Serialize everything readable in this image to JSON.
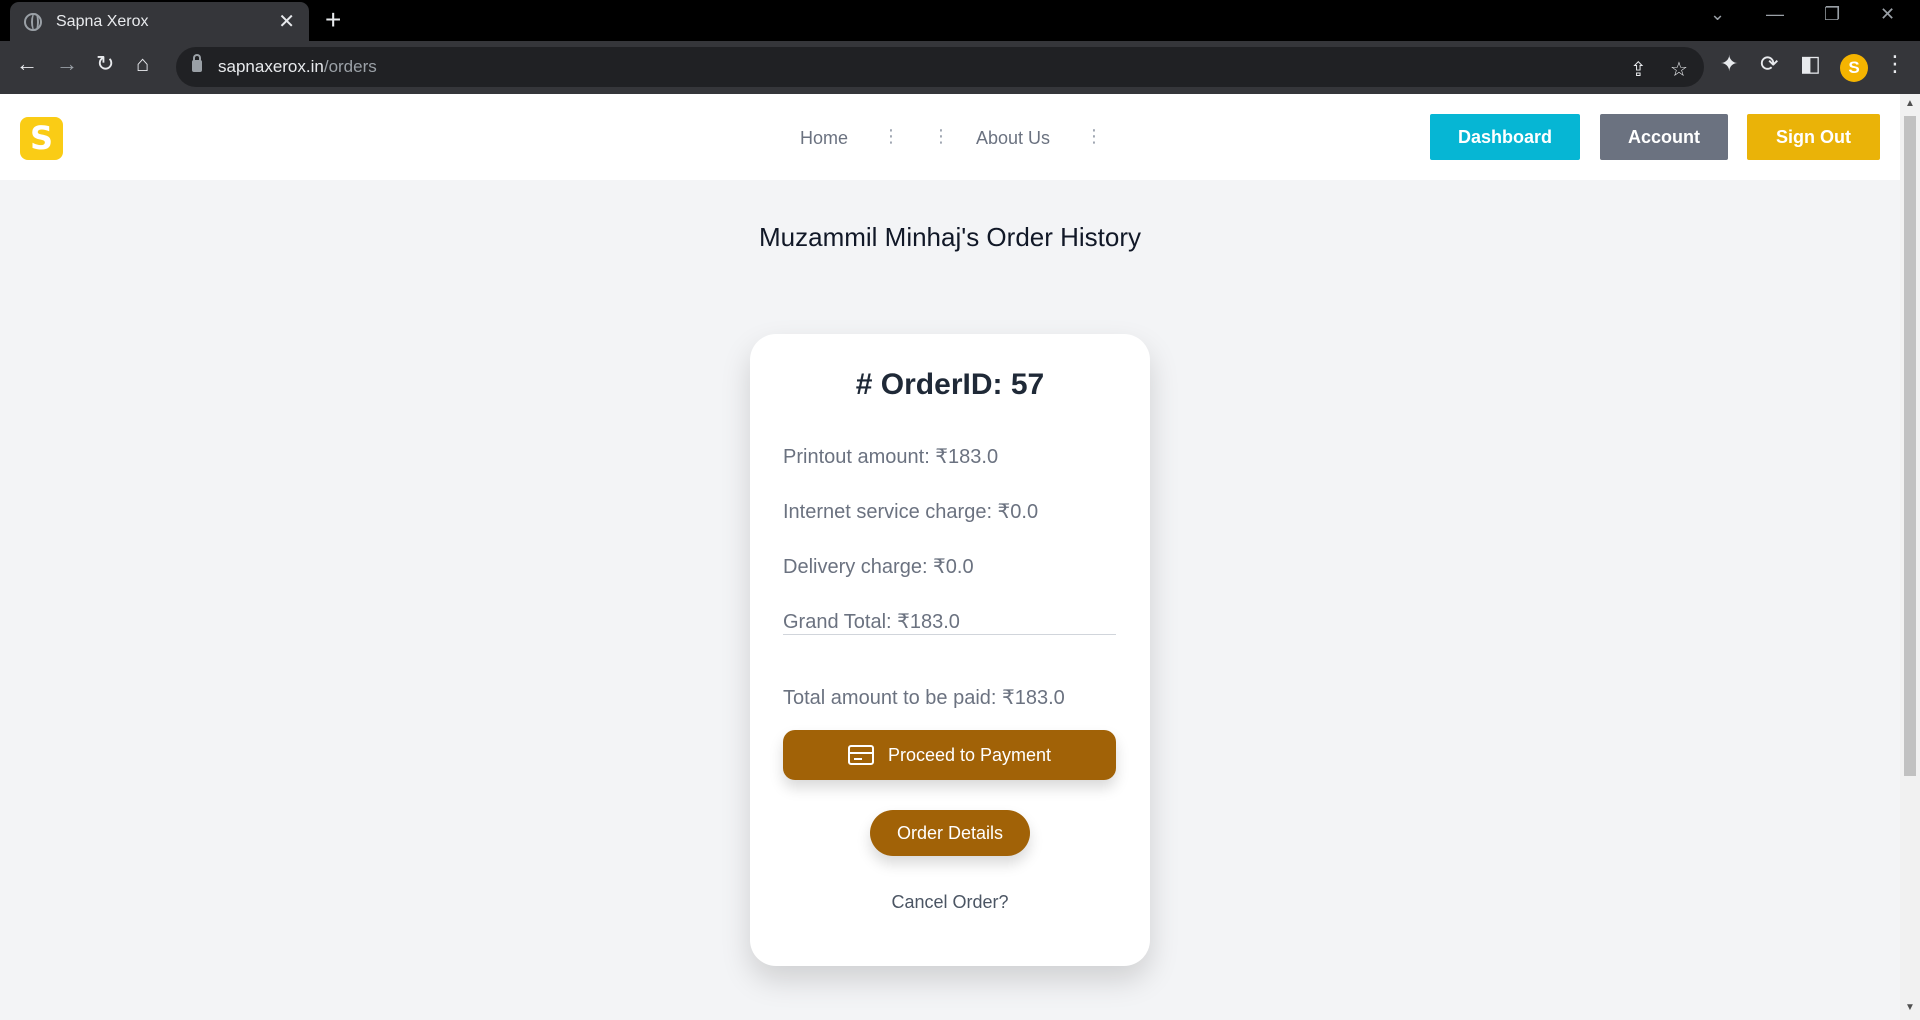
{
  "browser": {
    "tab_title": "Sapna Xerox",
    "url_host": "sapnaxerox.in",
    "url_path": "/orders",
    "profile_initial": "S",
    "new_tab_glyph": "+",
    "tab_close_glyph": "✕"
  },
  "nav": {
    "logo": "S",
    "links": {
      "home": "Home",
      "about": "About Us"
    },
    "buttons": {
      "dashboard": "Dashboard",
      "account": "Account",
      "signout": "Sign Out"
    }
  },
  "page": {
    "title": "Muzammil Minhaj's Order History"
  },
  "order": {
    "id_label": "# OrderID: 57",
    "printout": "Printout amount: ₹183.0",
    "internet_charge": "Internet service charge: ₹0.0",
    "delivery_charge": "Delivery charge: ₹0.0",
    "grand_total": "Grand Total: ₹183.0",
    "to_be_paid": "Total amount to be paid: ₹183.0",
    "pay_button": "Proceed to Payment",
    "details_button": "Order Details",
    "cancel_link": "Cancel Order?"
  },
  "colors": {
    "brand_yellow": "#facc15",
    "dashboard": "#06b6d4",
    "account": "#6b7280",
    "signout": "#eab308",
    "action_brown": "#a16207"
  },
  "icons": [
    "back-arrow-icon",
    "forward-arrow-icon",
    "reload-icon",
    "home-icon",
    "lock-icon",
    "share-icon",
    "star-icon",
    "extensions-icon",
    "sidebar-icon",
    "menu-icon",
    "credit-card-icon"
  ]
}
